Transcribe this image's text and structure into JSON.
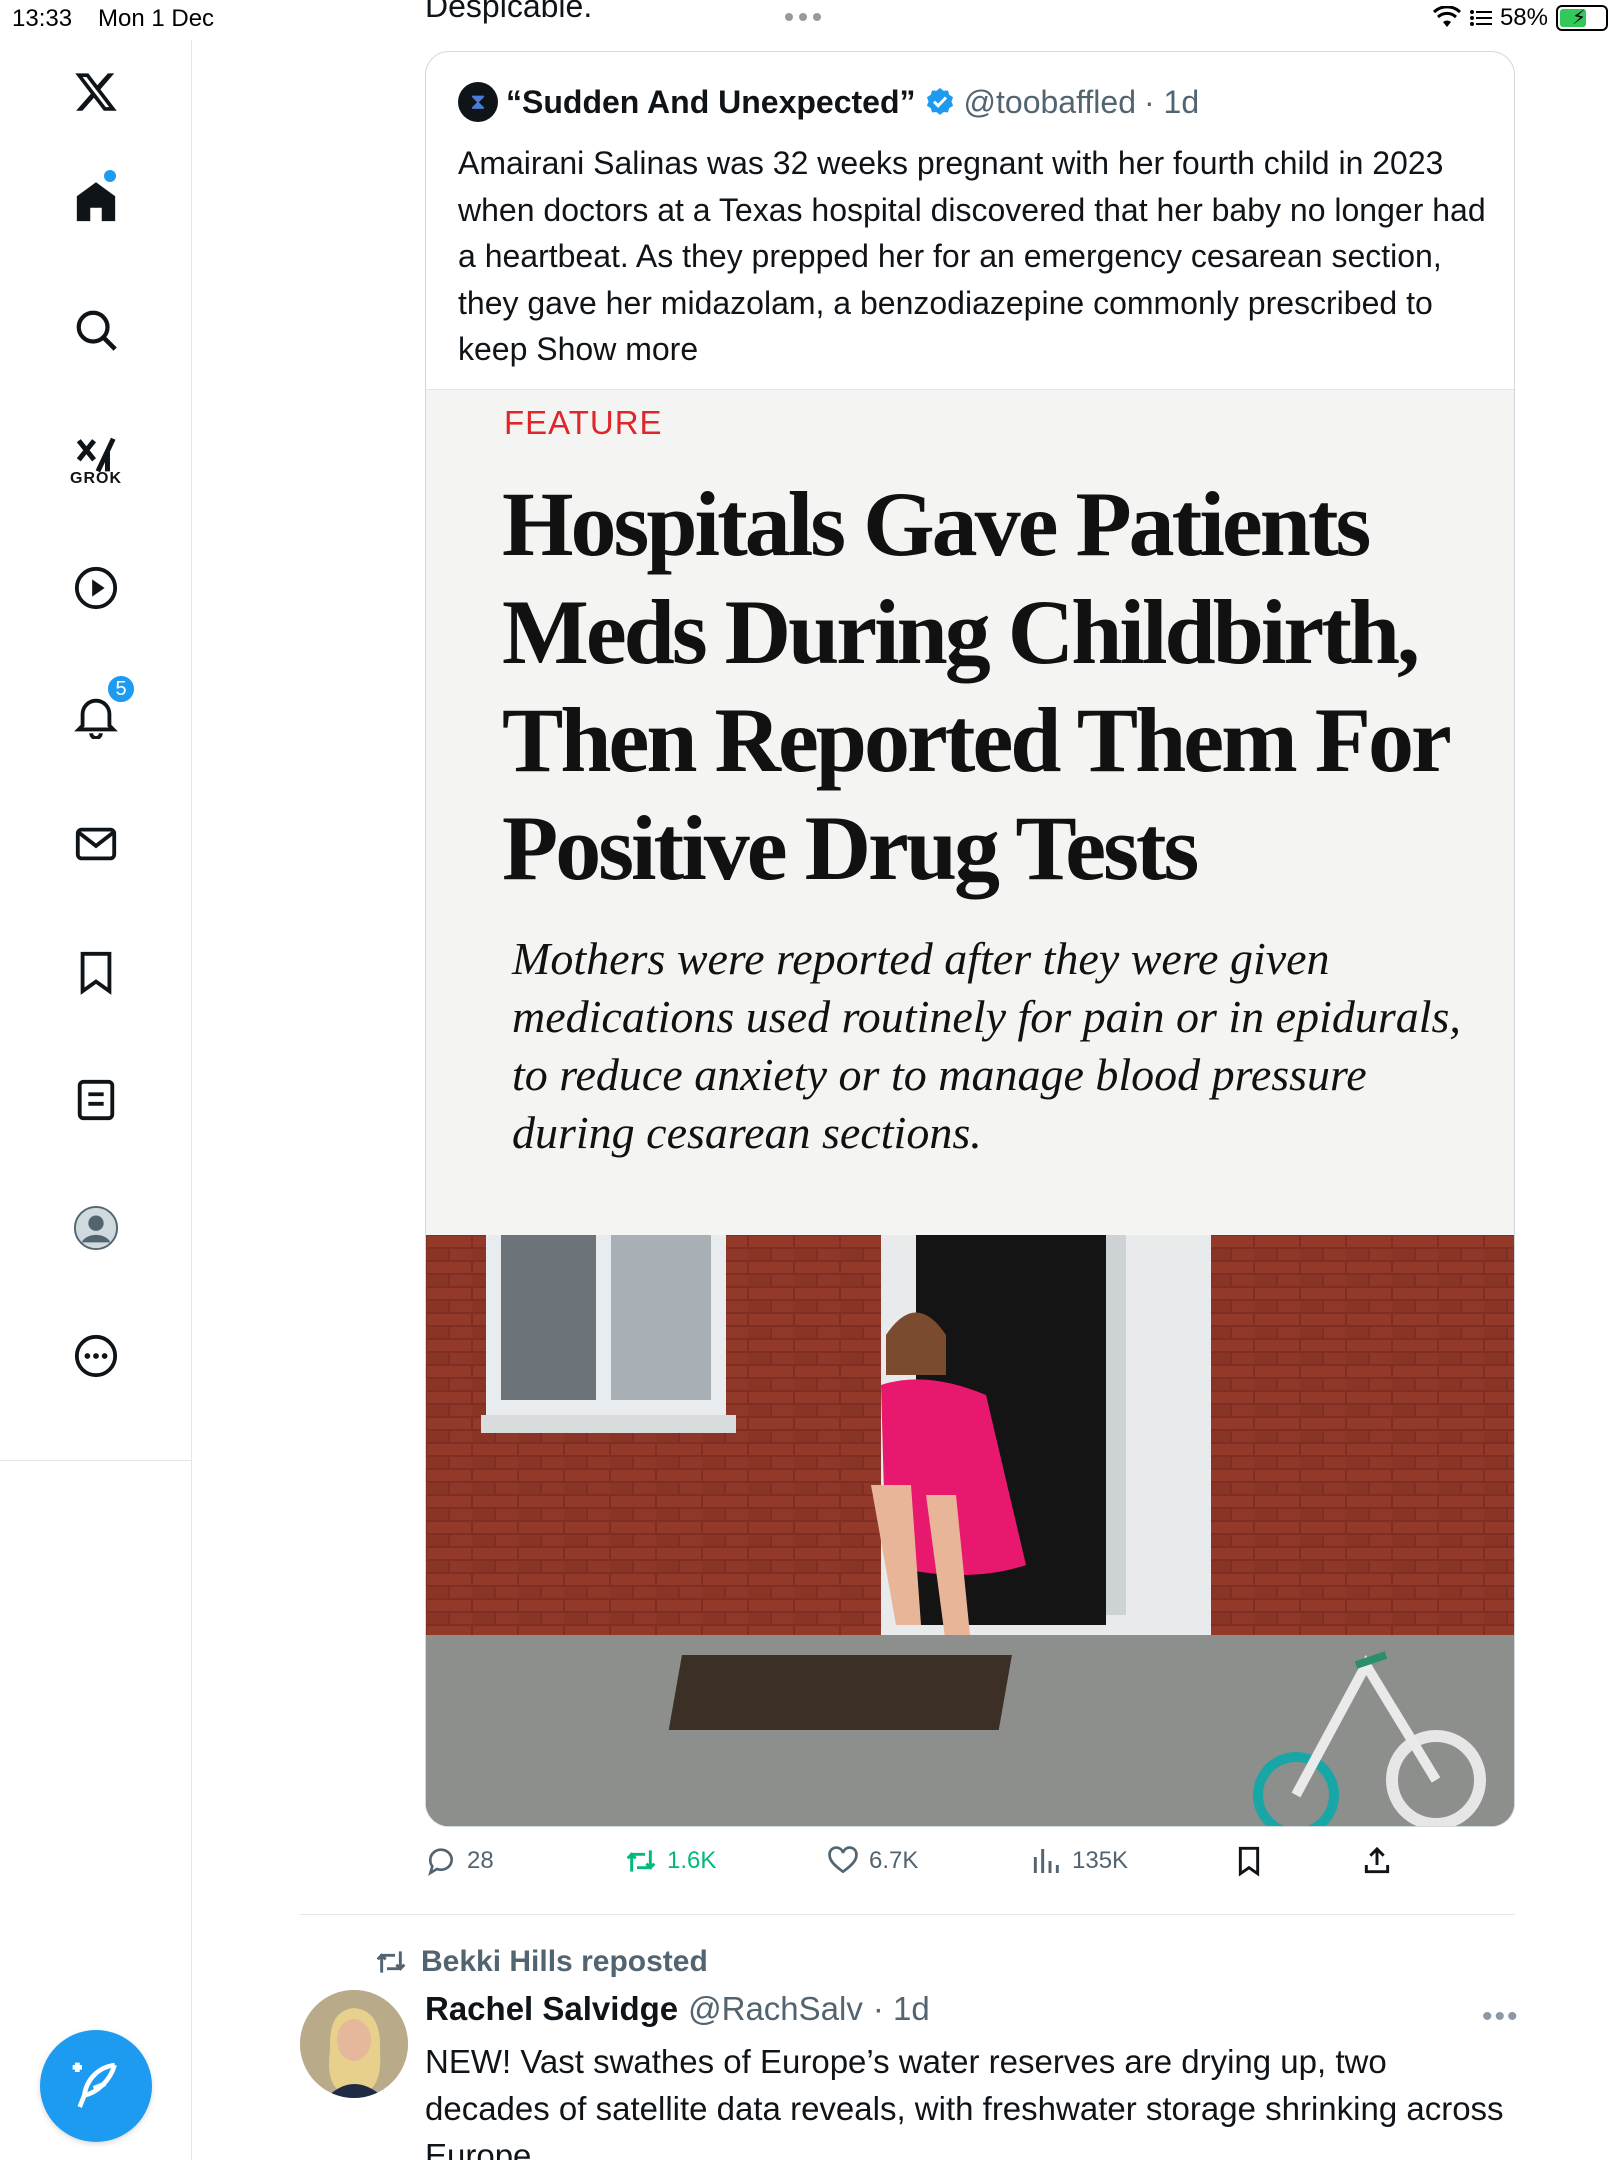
{
  "status_bar": {
    "time": "13:33",
    "date": "Mon 1 Dec",
    "battery": "58%"
  },
  "top_text": "Despicable.",
  "sidebar": {
    "grok_label": "GROK",
    "notification_count": "5",
    "accent_color": "#1d9bf0"
  },
  "quote": {
    "name": "“Sudden And Unexpected”",
    "handle": "@toobaffled",
    "time": "· 1d",
    "text": "Amairani Salinas was 32 weeks pregnant with her fourth child in 2023 when doctors at a Texas hospital discovered that her baby no longer had a heartbeat. As they prepped her for an emergency cesarean section, they gave her midazolam, a benzodiazepine commonly prescribed to keep ",
    "show_more": "Show more",
    "article": {
      "label": "FEATURE",
      "headline": "Hospitals Gave Patients Meds During Childbirth, Then Reported Them For Positive Drug Tests",
      "dek": "Mothers were reported after they were given medications used routinely for pain or in epidurals, to reduce anxiety or to manage blood pressure during cesarean sections."
    }
  },
  "actions": {
    "replies": "28",
    "reposts": "1.6K",
    "likes": "6.7K",
    "views": "135K"
  },
  "next_tweet": {
    "reposted_by": "Bekki Hills reposted",
    "name": "Rachel Salvidge",
    "handle": "@RachSalv",
    "time": "· 1d",
    "text": "NEW! Vast swathes of Europe’s water reserves are drying up, two decades of satellite data reveals, with freshwater storage shrinking across Europe"
  }
}
